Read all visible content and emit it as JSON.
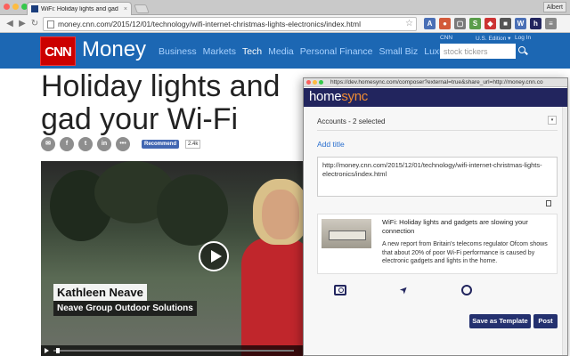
{
  "browser": {
    "tab_title": "WiFi: Holiday lights and gad",
    "tab_close": "×",
    "user": "Albert",
    "url": "money.cnn.com/2015/12/01/technology/wifi-internet-christmas-lights-electronics/index.html",
    "back": "◀",
    "forward": "▶",
    "reload": "↻",
    "bookmark_star": "☆",
    "extensions": [
      {
        "label": "A",
        "color": "#4a6fb5"
      },
      {
        "label": "●",
        "color": "#d35a3a"
      },
      {
        "label": "▢",
        "color": "#7a7a7a"
      },
      {
        "label": "S",
        "color": "#5a9d4a"
      },
      {
        "label": "◆",
        "color": "#c33"
      },
      {
        "label": "■",
        "color": "#555"
      },
      {
        "label": "W",
        "color": "#4a6fb5"
      },
      {
        "label": "h",
        "color": "#22255e"
      },
      {
        "label": "≡",
        "color": "#888"
      }
    ]
  },
  "cnn": {
    "logo": "CNN",
    "money": "Money",
    "nav": [
      "Business",
      "Markets",
      "Tech",
      "Media",
      "Personal Finance",
      "Small Biz",
      "Luxury"
    ],
    "active_nav": "Tech",
    "top_links": [
      "CNN",
      "U.S. Edition ▾",
      "Log In"
    ],
    "search_placeholder": "stock tickers",
    "headline": "Holiday lights and gadgets are slowing your Wi-Fi",
    "headline_visible": "Holiday lights and gad your Wi-Fi",
    "share": [
      "✉",
      "f",
      "t",
      "in",
      "•••"
    ],
    "fb_recommend": "Recommend",
    "fb_count": "2.4k",
    "video": {
      "name": "Kathleen Neave",
      "org": "Neave Group Outdoor Solutions",
      "progress": 0.01
    }
  },
  "popup": {
    "url": "https://dev.homesync.com/composer?external=true&share_url=http://money.cnn.co",
    "brand_home": "home",
    "brand_sync": "sync",
    "accounts": "Accounts - 2 selected",
    "accounts_arrow": "▾",
    "add_title": "Add title",
    "message": "http://money.cnn.com/2015/12/01/technology/wifi-internet-christmas-lights-electronics/index.html",
    "card_title": "WiFi: Holiday lights and gadgets are slowing your connection",
    "card_desc": "A new report from Britain's telecoms regulator Ofcom shows that about 20% of poor Wi-Fi performance is caused by electronic gadgets and lights in the home.",
    "locate_glyph": "➤",
    "btn_template": "Save as Template",
    "btn_post": "Post"
  },
  "colors": {
    "cnn_blue": "#1c67b3",
    "cnn_red": "#cc0000",
    "homesync_navy": "#22255e",
    "homesync_orange": "#ee8b32"
  }
}
